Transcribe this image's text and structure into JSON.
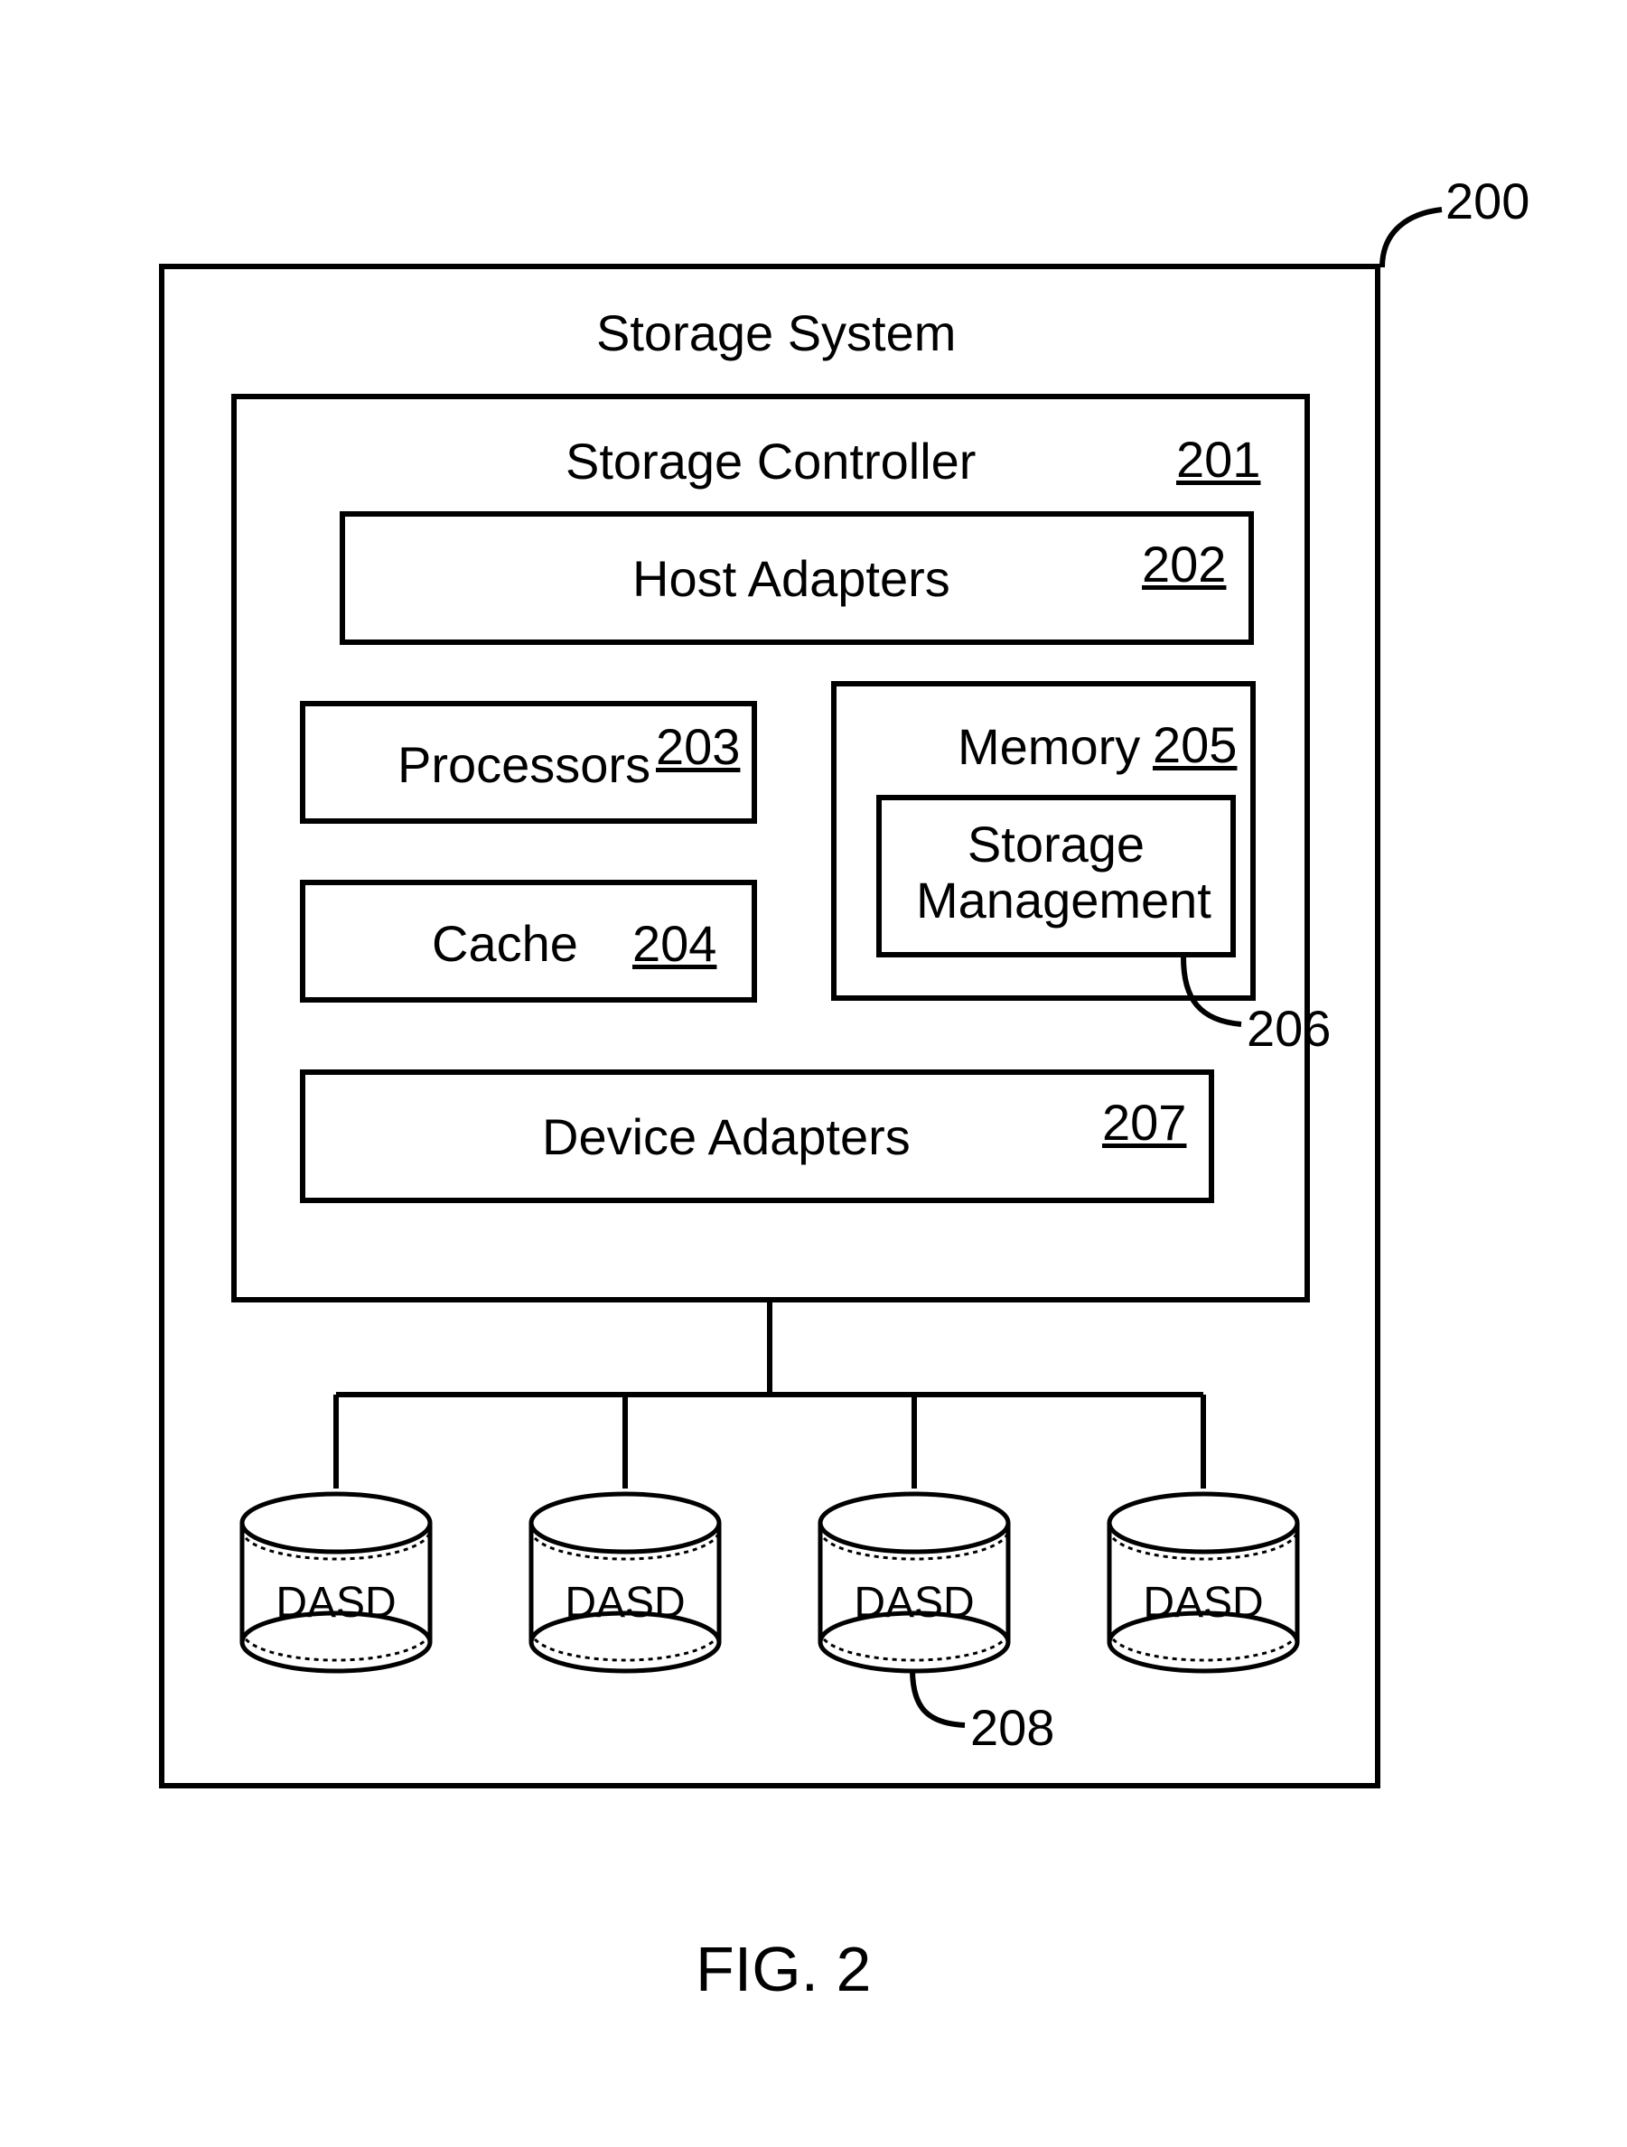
{
  "storage_system": {
    "label": "Storage System",
    "ref": "200"
  },
  "storage_controller": {
    "label": "Storage Controller",
    "ref": "201"
  },
  "host_adapters": {
    "label": "Host Adapters",
    "ref": "202"
  },
  "processors": {
    "label": "Processors",
    "ref": "203"
  },
  "cache": {
    "label": "Cache",
    "ref": "204"
  },
  "memory": {
    "label": "Memory",
    "ref": "205"
  },
  "storage_management": {
    "label": "Storage\nManagement",
    "ref": "206"
  },
  "device_adapters": {
    "label": "Device Adapters",
    "ref": "207"
  },
  "dasd": {
    "label": "DASD",
    "ref": "208"
  },
  "figure": {
    "label": "FIG. 2"
  }
}
